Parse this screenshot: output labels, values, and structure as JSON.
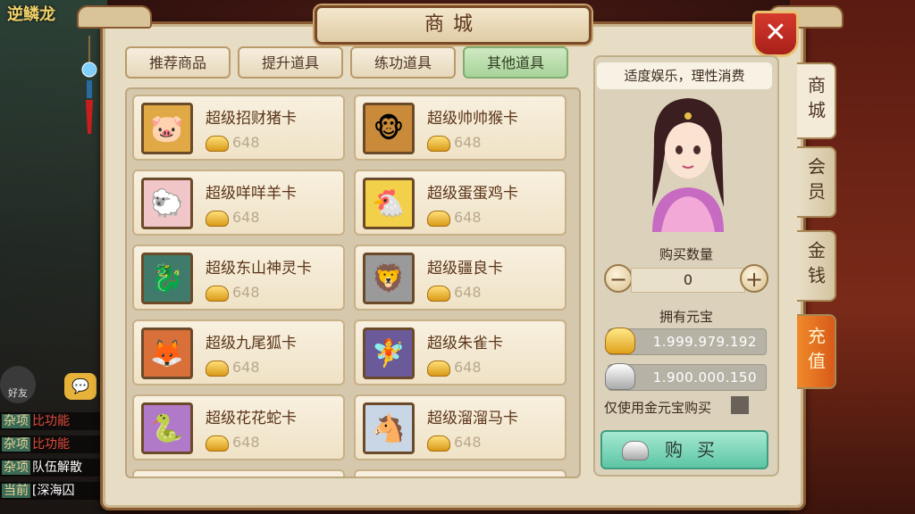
{
  "background": {
    "title": "逆鳞龙",
    "friend_label": "好友",
    "chat_lines": [
      {
        "tag": "杂项",
        "text": "比功能"
      },
      {
        "tag": "杂项",
        "text": "比功能"
      },
      {
        "tag": "杂项",
        "text": "队伍解散"
      },
      {
        "tag": "当前",
        "text": "[深海囚"
      }
    ]
  },
  "shop": {
    "title": "商城",
    "close_label": "✕",
    "tabs": [
      {
        "label": "推荐商品",
        "active": false
      },
      {
        "label": "提升道具",
        "active": false
      },
      {
        "label": "练功道具",
        "active": false
      },
      {
        "label": "其他道具",
        "active": true
      }
    ],
    "items": [
      {
        "name": "超级招财猪卡",
        "price": "648",
        "icon": "pig-card-icon",
        "emoji": "🐷",
        "color": "#e0a945"
      },
      {
        "name": "超级帅帅猴卡",
        "price": "648",
        "icon": "monkey-card-icon",
        "emoji": "🐵",
        "color": "#c98a3a"
      },
      {
        "name": "超级咩咩羊卡",
        "price": "648",
        "icon": "sheep-card-icon",
        "emoji": "🐑",
        "color": "#f0c6c8"
      },
      {
        "name": "超级蛋蛋鸡卡",
        "price": "648",
        "icon": "chicken-card-icon",
        "emoji": "🐔",
        "color": "#f2d04a"
      },
      {
        "name": "超级东山神灵卡",
        "price": "648",
        "icon": "dragon-card-icon",
        "emoji": "🐉",
        "color": "#3f7a6a"
      },
      {
        "name": "超级疆良卡",
        "price": "648",
        "icon": "beast-card-icon",
        "emoji": "🦁",
        "color": "#9a9a9a"
      },
      {
        "name": "超级九尾狐卡",
        "price": "648",
        "icon": "fox-card-icon",
        "emoji": "🦊",
        "color": "#d9703a"
      },
      {
        "name": "超级朱雀卡",
        "price": "648",
        "icon": "phoenix-card-icon",
        "emoji": "🧚",
        "color": "#6a5a9a"
      },
      {
        "name": "超级花花蛇卡",
        "price": "648",
        "icon": "snake-card-icon",
        "emoji": "🐍",
        "color": "#b07ac8"
      },
      {
        "name": "超级溜溜马卡",
        "price": "648",
        "icon": "horse-card-icon",
        "emoji": "🐴",
        "color": "#c9d6e6"
      }
    ],
    "side_tabs": [
      {
        "label": "商城",
        "active": true
      },
      {
        "label": "会员",
        "active": false
      },
      {
        "label": "金钱",
        "active": false
      },
      {
        "label": "充值",
        "active": false,
        "highlight": true
      }
    ]
  },
  "purchase": {
    "slogan": "适度娱乐，理性消费",
    "quantity_label": "购买数量",
    "quantity": "0",
    "minus_label": "−",
    "plus_label": "+",
    "owned_label": "拥有元宝",
    "gold_ingots": "1.999.979.192",
    "silver_ingots": "1.900.000.150",
    "only_gold_label": "仅使用金元宝购买",
    "only_gold_checked": false,
    "buy_label": "购买"
  },
  "colors": {
    "frame": "#e7dcc4",
    "active_tab": "#a8d39a",
    "buy_button": "#5cc6a4",
    "recharge_tab": "#e0701e",
    "close_button": "#c12b22"
  }
}
